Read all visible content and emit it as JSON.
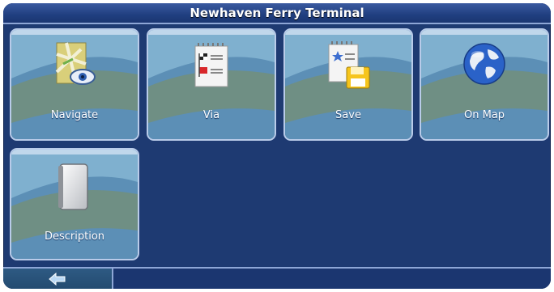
{
  "title": "Newhaven Ferry Terminal",
  "tiles": [
    {
      "label": "Navigate",
      "icon": "map-eye-icon"
    },
    {
      "label": "Via",
      "icon": "waypoint-flags-icon"
    },
    {
      "label": "Save",
      "icon": "save-floppy-icon"
    },
    {
      "label": "On Map",
      "icon": "globe-icon"
    },
    {
      "label": "Description",
      "icon": "blank-page-icon"
    }
  ],
  "footer": {
    "back_icon": "back-arrow-icon"
  },
  "colors": {
    "background": "#1e3a72",
    "tile_border": "#b9cbe9",
    "accent": "#8ea6d6"
  }
}
